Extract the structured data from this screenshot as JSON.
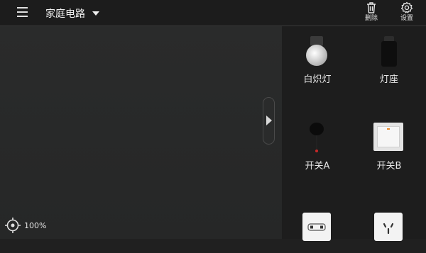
{
  "header": {
    "title": "家庭电路",
    "tools": [
      {
        "label": "删除",
        "icon": "trash-icon"
      },
      {
        "label": "设置",
        "icon": "gear-icon"
      }
    ]
  },
  "canvas": {
    "zoom_label": "100%"
  },
  "palette": {
    "items": [
      {
        "label": "白炽灯",
        "icon": "light-bulb-icon"
      },
      {
        "label": "灯座",
        "icon": "lamp-socket-icon"
      },
      {
        "label": "开关A",
        "icon": "pull-switch-icon"
      },
      {
        "label": "开关B",
        "icon": "rocker-switch-icon"
      },
      {
        "label": "",
        "icon": "two-pin-outlet-icon"
      },
      {
        "label": "",
        "icon": "three-pin-outlet-icon"
      }
    ]
  }
}
